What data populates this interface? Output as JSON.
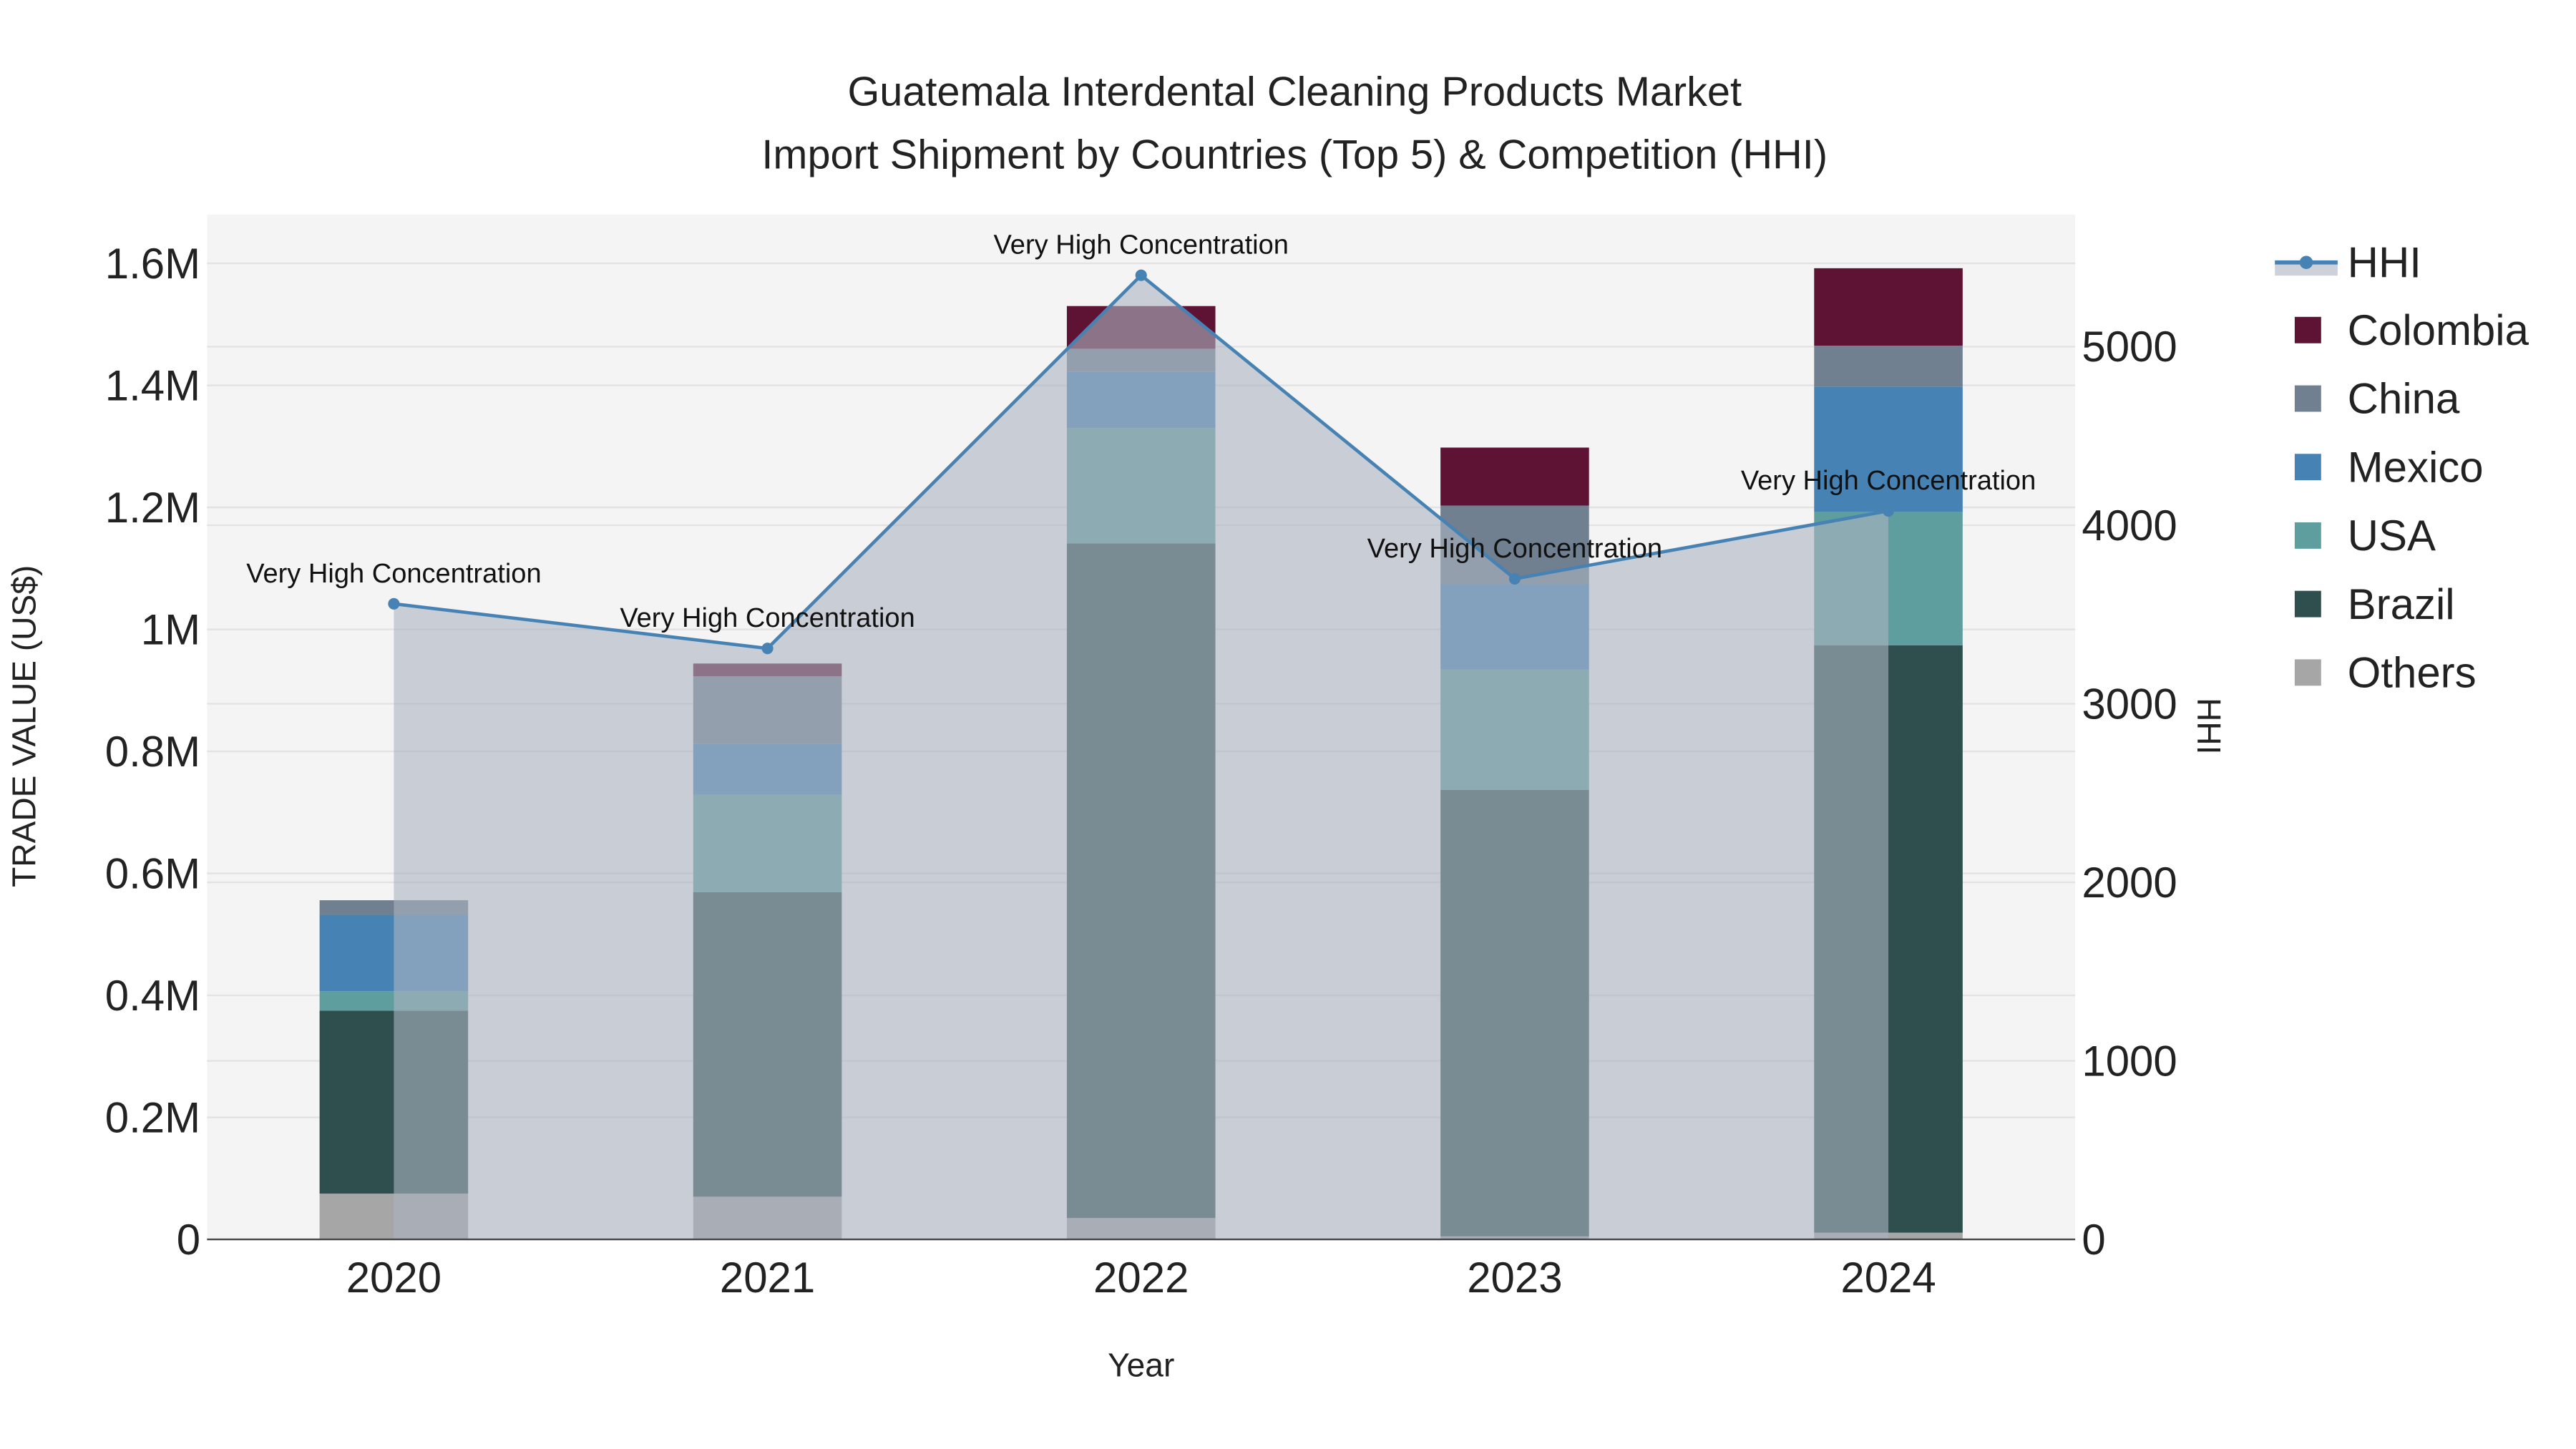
{
  "chart_data": {
    "type": "bar",
    "stacked": true,
    "title": "Guatemala Interdental Cleaning Products Market",
    "subtitle": "Import Shipment by Countries (Top 5) & Competition (HHI)",
    "xlabel": "Year",
    "ylabel": "TRADE VALUE (US$)",
    "y2label": "HHI",
    "categories": [
      "2020",
      "2021",
      "2022",
      "2023",
      "2024"
    ],
    "ylim": [
      0,
      1680000
    ],
    "y2lim": [
      0,
      5740
    ],
    "yticks": [
      0,
      200000,
      400000,
      600000,
      800000,
      1000000,
      1200000,
      1400000,
      1600000
    ],
    "ytick_labels": [
      "0",
      "0.2M",
      "0.4M",
      "0.6M",
      "0.8M",
      "1M",
      "1.2M",
      "1.4M",
      "1.6M"
    ],
    "y2ticks": [
      0,
      1000,
      2000,
      3000,
      4000,
      5000
    ],
    "y2tick_labels": [
      "0",
      "1000",
      "2000",
      "3000",
      "4000",
      "5000"
    ],
    "grid": true,
    "legend_position": "right",
    "series": [
      {
        "name": "Others",
        "color": "#a6a6a6",
        "values": [
          75000,
          70000,
          35000,
          5000,
          11000
        ]
      },
      {
        "name": "Brazil",
        "color": "#2f4f4f",
        "values": [
          300000,
          499000,
          1106000,
          732000,
          963000
        ]
      },
      {
        "name": "USA",
        "color": "#5f9e9e",
        "values": [
          32000,
          160000,
          189000,
          197000,
          219000
        ]
      },
      {
        "name": "Mexico",
        "color": "#4682b4",
        "values": [
          125000,
          83000,
          92000,
          140000,
          205000
        ]
      },
      {
        "name": "China",
        "color": "#708090",
        "values": [
          24000,
          111000,
          38000,
          129000,
          67000
        ]
      },
      {
        "name": "Colombia",
        "color": "#5f1334",
        "values": [
          0,
          21000,
          70000,
          95000,
          127000
        ]
      }
    ],
    "line_series": {
      "name": "HHI",
      "color": "#4682b4",
      "fill": "rgba(172,180,194,0.6)",
      "values": [
        3560,
        3310,
        5400,
        3700,
        4080
      ],
      "annotations": [
        "Very High Concentration",
        "Very High Concentration",
        "Very High Concentration",
        "Very High Concentration",
        "Very High Concentration"
      ]
    },
    "legend_order": [
      "HHI",
      "Colombia",
      "China",
      "Mexico",
      "USA",
      "Brazil",
      "Others"
    ]
  }
}
